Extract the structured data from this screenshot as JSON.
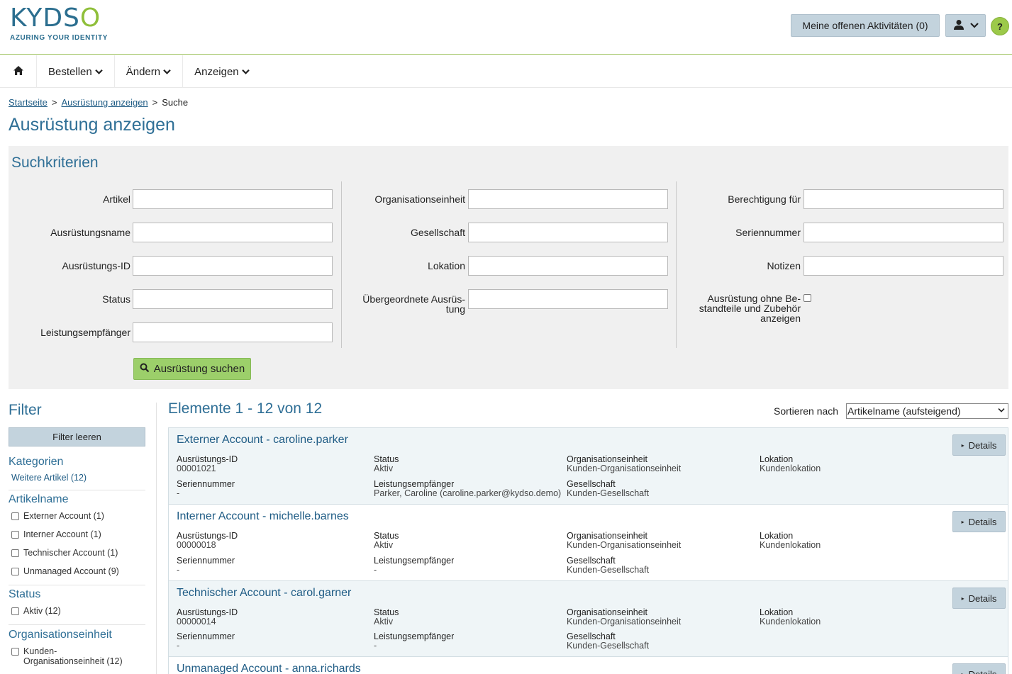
{
  "header": {
    "logo_text": "KYDSO",
    "logo_tagline": "AZURING YOUR IDENTITY",
    "activities_label": "Meine offenen Aktivitäten (0)",
    "help_label": "?"
  },
  "nav": {
    "items": [
      {
        "label": "Bestellen"
      },
      {
        "label": "Ändern"
      },
      {
        "label": "Anzeigen"
      }
    ]
  },
  "breadcrumb": {
    "items": [
      {
        "label": "Startseite"
      },
      {
        "label": "Ausrüstung anzeigen"
      },
      {
        "label": "Suche"
      }
    ],
    "separator": ">"
  },
  "page": {
    "title": "Ausrüstung anzeigen"
  },
  "search": {
    "title": "Suchkriterien",
    "col1": [
      "Artikel",
      "Ausrüstungsname",
      "Ausrüstungs-ID",
      "Status",
      "Leistungsempfänger"
    ],
    "col2": [
      "Organisationseinheit",
      "Gesellschaft",
      "Lokation",
      "Übergeordnete Ausrüs-",
      "tung"
    ],
    "col3": [
      "Berechtigung für",
      "Seriennummer",
      "Notizen",
      "Ausrüstung ohne Be-",
      "standteile und Zubehör",
      "anzeigen"
    ],
    "submit_label": "Ausrüstung suchen"
  },
  "filter": {
    "title": "Filter",
    "clear_label": "Filter leeren",
    "categories": {
      "title": "Kategorien",
      "link": "Weitere Artikel (12)"
    },
    "article_name": {
      "title": "Artikelname",
      "options": [
        "Externer Account (1)",
        "Interner Account (1)",
        "Technischer Account (1)",
        "Unmanaged Account (9)"
      ]
    },
    "status": {
      "title": "Status",
      "options": [
        "Aktiv (12)"
      ]
    },
    "org_unit": {
      "title": "Organisationseinheit",
      "options": [
        "Kunden-",
        "Organisationseinheit (12)"
      ]
    }
  },
  "results": {
    "title": "Elemente 1 - 12 von 12",
    "sort_label": "Sortieren nach",
    "sort_value": "Artikelname (aufsteigend)",
    "details_label": "Details",
    "labels": {
      "id": "Ausrüstungs-ID",
      "status": "Status",
      "org": "Organisationseinheit",
      "location": "Lokation",
      "serial": "Seriennummer",
      "recipient": "Leistungsempfänger",
      "company": "Gesellschaft"
    },
    "items": [
      {
        "title": "Externer Account - caroline.parker",
        "id": "00001021",
        "status": "Aktiv",
        "org": "Kunden-Organisationseinheit",
        "location": "Kundenlokation",
        "serial": "-",
        "recipient": "Parker, Caroline (caroline.parker@kydso.demo)",
        "company": "Kunden-Gesellschaft"
      },
      {
        "title": "Interner Account - michelle.barnes",
        "id": "00000018",
        "status": "Aktiv",
        "org": "Kunden-Organisationseinheit",
        "location": "Kundenlokation",
        "serial": "-",
        "recipient": "-",
        "company": "Kunden-Gesellschaft"
      },
      {
        "title": "Technischer Account - carol.garner",
        "id": "00000014",
        "status": "Aktiv",
        "org": "Kunden-Organisationseinheit",
        "location": "Kundenlokation",
        "serial": "-",
        "recipient": "-",
        "company": "Kunden-Gesellschaft"
      },
      {
        "title": "Unmanaged Account - anna.richards"
      }
    ]
  }
}
